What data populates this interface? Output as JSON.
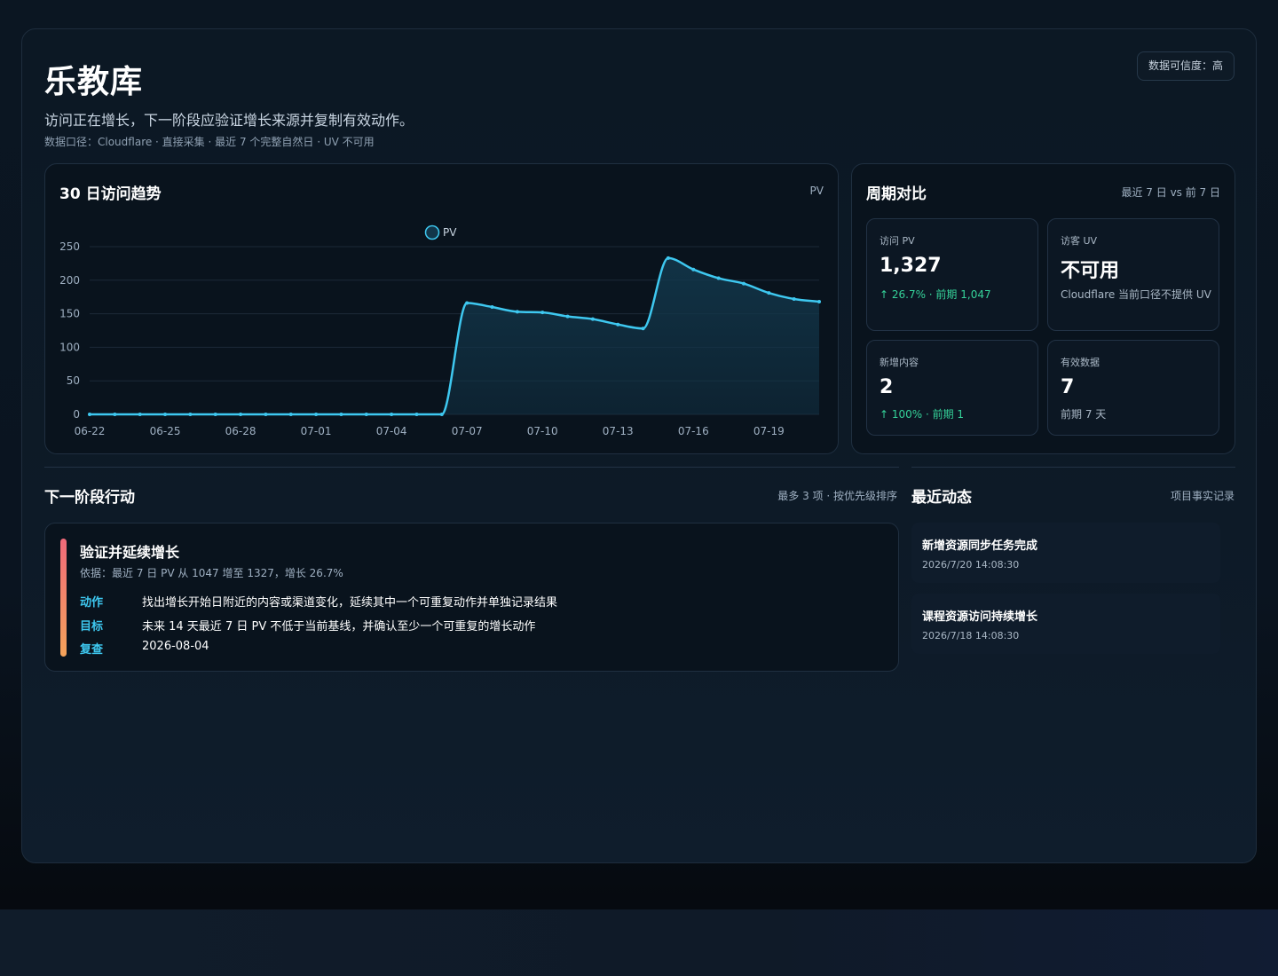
{
  "header": {
    "title": "乐教库",
    "confidence": "数据可信度：高",
    "subtitle": "访问正在增长，下一阶段应验证增长来源并复制有效动作。",
    "meta": "数据口径：Cloudflare · 直接采集 · 最近 7 个完整自然日 · UV 不可用"
  },
  "trend": {
    "title": "30 日访问趋势",
    "unit": "PV"
  },
  "chart_data": {
    "type": "area",
    "title": "30 日访问趋势",
    "x": [
      "06-22",
      "06-23",
      "06-24",
      "06-25",
      "06-26",
      "06-27",
      "06-28",
      "06-29",
      "06-30",
      "07-01",
      "07-02",
      "07-03",
      "07-04",
      "07-05",
      "07-06",
      "07-07",
      "07-08",
      "07-09",
      "07-10",
      "07-11",
      "07-12",
      "07-13",
      "07-14",
      "07-15",
      "07-16",
      "07-17",
      "07-18",
      "07-19",
      "07-20",
      "07-21"
    ],
    "x_tick_labels": [
      "06-22",
      "06-25",
      "06-28",
      "07-01",
      "07-04",
      "07-07",
      "07-10",
      "07-13",
      "07-16",
      "07-19"
    ],
    "series": [
      {
        "name": "PV",
        "values": [
          0,
          0,
          0,
          0,
          0,
          0,
          0,
          0,
          0,
          0,
          0,
          0,
          0,
          0,
          0,
          166,
          160,
          153,
          152,
          146,
          142,
          134,
          128,
          233,
          216,
          203,
          195,
          181,
          172,
          168
        ]
      }
    ],
    "ylim": [
      0,
      250
    ],
    "y_ticks": [
      0,
      50,
      100,
      150,
      200,
      250
    ],
    "grid": true,
    "legend": "top-center",
    "colors": {
      "line": "#3ec8f0",
      "fill": "#12364a"
    }
  },
  "compare": {
    "title": "周期对比",
    "note": "最近 7 日 vs 前 7 日",
    "stats": [
      {
        "label": "访问 PV",
        "value": "1,327",
        "sub": "↑ 26.7% · 前期 1,047"
      },
      {
        "label": "访客 UV",
        "value": "不可用",
        "sub": "Cloudflare 当前口径不提供 UV"
      },
      {
        "label": "新增内容",
        "value": "2",
        "sub": "↑ 100% · 前期 1"
      },
      {
        "label": "有效数据",
        "value": "7",
        "sub": "前期 7 天"
      }
    ]
  },
  "actions": {
    "title": "下一阶段行动",
    "note": "最多 3 项 · 按优先级排序",
    "items": [
      {
        "title": "验证并延续增长",
        "basis": "依据：最近 7 日 PV 从 1047 增至 1327，增长 26.7%",
        "action_key": "动作",
        "action_val": "找出增长开始日附近的内容或渠道变化，延续其中一个可重复动作并单独记录结果",
        "goal_key": "目标",
        "goal_val": "未来 14 天最近 7 日 PV 不低于当前基线，并确认至少一个可重复的增长动作",
        "review_key": "复查",
        "review_val": "2026-08-04"
      }
    ]
  },
  "feed": {
    "title": "最近动态",
    "note": "项目事实记录",
    "items": [
      {
        "title": "新增资源同步任务完成",
        "time": "2026/7/20 14:08:30"
      },
      {
        "title": "课程资源访问持续增长",
        "time": "2026/7/18 14:08:30"
      }
    ]
  },
  "colors": {
    "accent": "#3ec8f0",
    "positive": "#35d39a",
    "priority_start": "#f06a7a",
    "priority_end": "#f4a35a"
  }
}
